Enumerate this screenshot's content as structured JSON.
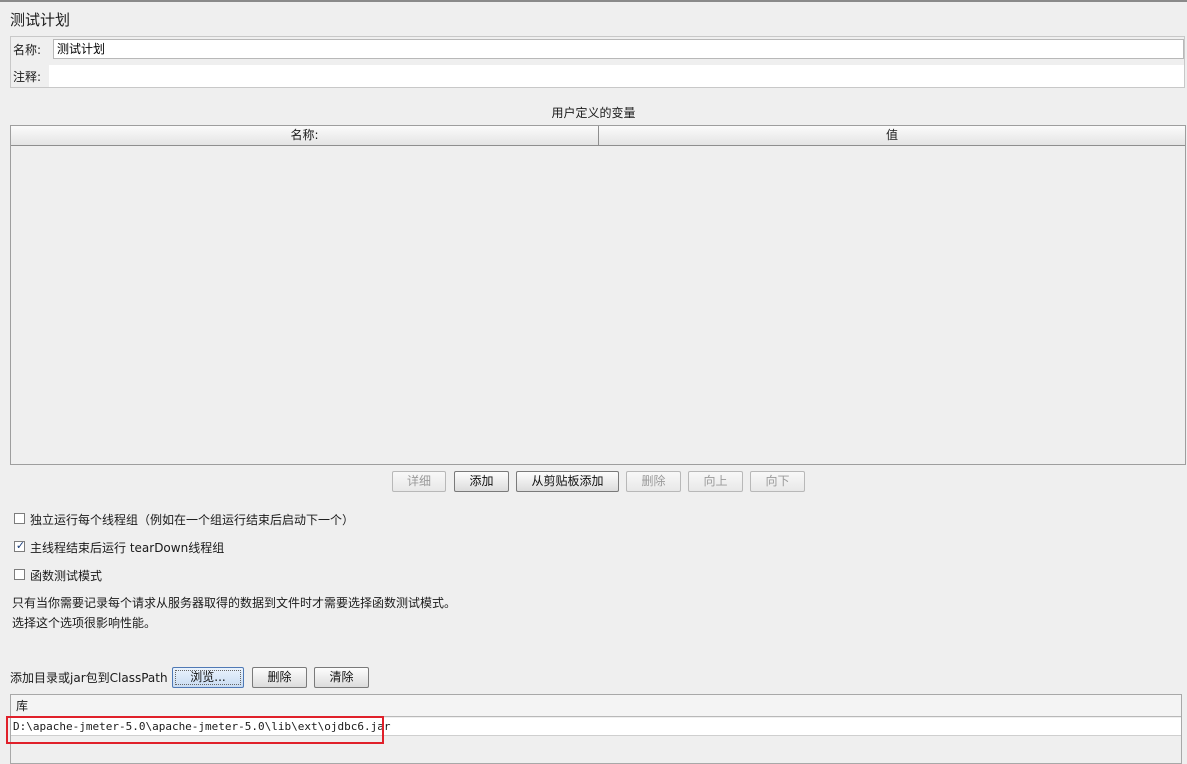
{
  "page": {
    "title": "测试计划"
  },
  "name_panel": {
    "name_label": "名称:",
    "name_value": "测试计划",
    "comment_label": "注释:",
    "comment_value": ""
  },
  "user_vars": {
    "title": "用户定义的变量",
    "columns": [
      "名称:",
      "值"
    ],
    "rows": []
  },
  "var_buttons": {
    "detail": "详细",
    "add": "添加",
    "add_from_clipboard": "从剪贴板添加",
    "delete": "删除",
    "up": "向上",
    "down": "向下"
  },
  "options": {
    "serialize_groups": {
      "label": "独立运行每个线程组（例如在一个组运行结束后启动下一个）",
      "checked": false
    },
    "teardown_on_shutdown": {
      "label": "主线程结束后运行 tearDown线程组",
      "checked": true
    },
    "functional_mode": {
      "label": "函数测试模式",
      "checked": false
    }
  },
  "notes": {
    "line1": "只有当你需要记录每个请求从服务器取得的数据到文件时才需要选择函数测试模式。",
    "line2": "选择这个选项很影响性能。"
  },
  "classpath": {
    "label": "添加目录或jar包到ClassPath",
    "browse": "浏览...",
    "delete": "删除",
    "clear": "清除",
    "library_header": "库",
    "libraries": [
      "D:\\apache-jmeter-5.0\\apache-jmeter-5.0\\lib\\ext\\ojdbc6.jar"
    ]
  },
  "colors": {
    "background": "#efefef",
    "highlight": "#e0202a",
    "focus_button": "#c9dcf2"
  }
}
